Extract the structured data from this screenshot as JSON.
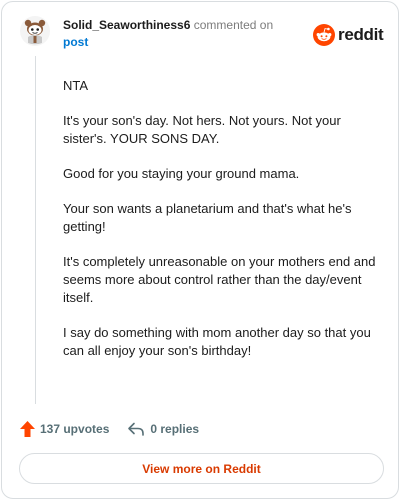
{
  "header": {
    "username": "Solid_Seaworthiness6",
    "action_text": "commented on",
    "post_link": "post",
    "brand": "reddit",
    "avatar_icon": "snoo-avatar-icon",
    "brand_icon": "reddit-snoo-icon"
  },
  "comment": {
    "paragraphs": [
      "NTA",
      "It's your son's day. Not hers. Not yours. Not your sister's. YOUR SONS DAY.",
      "Good for you staying your ground mama.",
      "Your son wants a planetarium and that's what he's getting!",
      "It's completely unreasonable on your mothers end and seems more about control rather than the day/event itself.",
      "I say do something with mom another day so that you can all enjoy your son's birthday!"
    ]
  },
  "actions": {
    "upvotes_label": "137 upvotes",
    "replies_label": "0 replies",
    "upvote_icon": "upvote-arrow-icon",
    "reply_icon": "reply-arrow-icon"
  },
  "footer": {
    "view_more_label": "View more on Reddit"
  },
  "colors": {
    "brand_orange": "#ff4500",
    "link_blue": "#0079d3",
    "view_more_text": "#d93a00",
    "meta_gray": "#576f76",
    "border": "#d9dde0"
  }
}
